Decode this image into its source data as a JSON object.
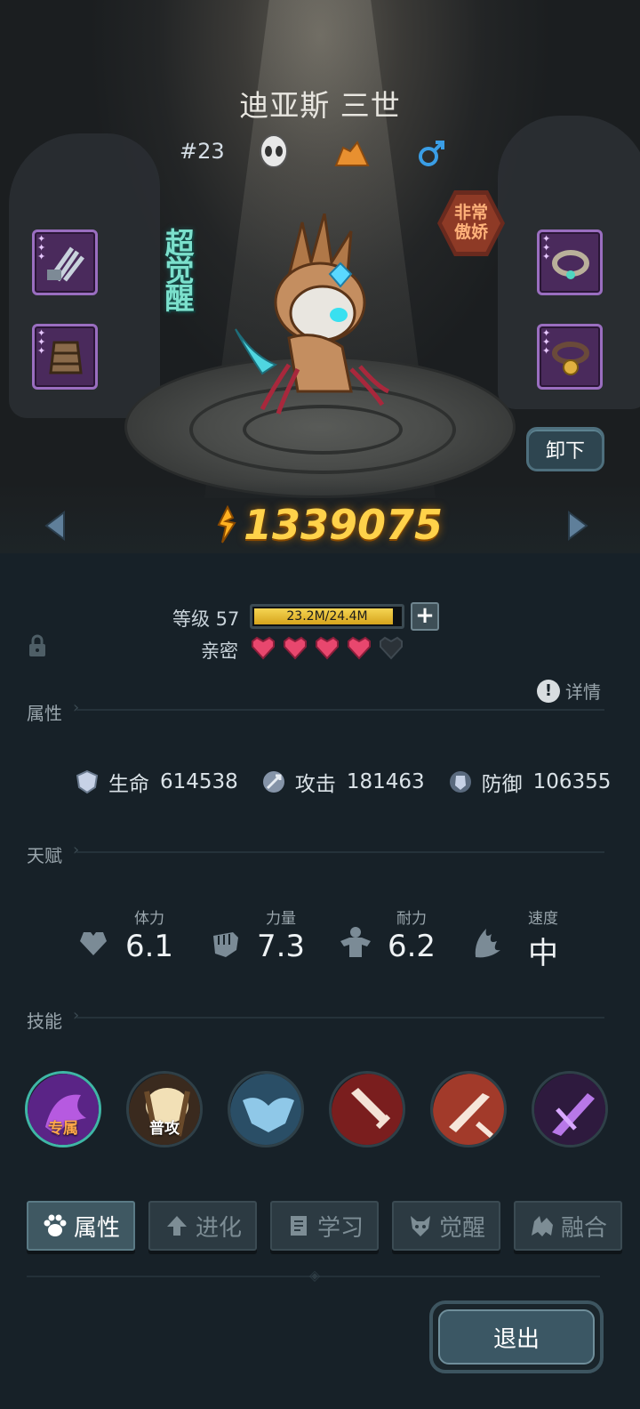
{
  "hero": {
    "name": "迪亚斯 三世",
    "id": "#23",
    "trait": "非常\n傲娇",
    "awaken_badge": "超觉醒",
    "power": "1339075"
  },
  "equipment": {
    "left": [
      {
        "icon": "claw-equip-icon"
      },
      {
        "icon": "armor-equip-icon"
      }
    ],
    "right": [
      {
        "icon": "collar-equip-icon"
      },
      {
        "icon": "bell-collar-equip-icon"
      }
    ]
  },
  "buttons": {
    "unload": "卸下",
    "exit": "退出"
  },
  "level": {
    "label": "等级 57",
    "exp_text": "23.2M/24.4M",
    "exp_fraction": 0.951
  },
  "intimacy": {
    "label": "亲密",
    "filled": 4,
    "total": 5
  },
  "details_label": "详情",
  "sections": {
    "attributes": "属性",
    "talents": "天赋",
    "skills": "技能"
  },
  "stats": [
    {
      "name": "生命",
      "value": "614538",
      "icon": "health-shield-icon"
    },
    {
      "name": "攻击",
      "value": "181463",
      "icon": "sword-icon"
    },
    {
      "name": "防御",
      "value": "106355",
      "icon": "armor-shield-icon"
    }
  ],
  "talents": [
    {
      "name": "体力",
      "value": "6.1",
      "icon": "heart-icon"
    },
    {
      "name": "力量",
      "value": "7.3",
      "icon": "fist-icon"
    },
    {
      "name": "耐力",
      "value": "6.2",
      "icon": "muscle-icon"
    },
    {
      "name": "速度",
      "value": "中",
      "icon": "wing-icon"
    }
  ],
  "skills": [
    {
      "label": "专属",
      "color": "#6a2a9a"
    },
    {
      "label": "普攻",
      "color": "#c9a66b"
    },
    {
      "label": "",
      "color": "#3f6f8e"
    },
    {
      "label": "",
      "color": "#8a2a2a"
    },
    {
      "label": "",
      "color": "#9a3a2a"
    },
    {
      "label": "",
      "color": "#4a2a6a"
    }
  ],
  "tabs": [
    {
      "label": "属性",
      "icon": "paw-icon",
      "active": true
    },
    {
      "label": "进化",
      "icon": "up-arrow-icon",
      "active": false
    },
    {
      "label": "学习",
      "icon": "book-icon",
      "active": false
    },
    {
      "label": "觉醒",
      "icon": "wolf-icon",
      "active": false
    },
    {
      "label": "融合",
      "icon": "beast-icon",
      "active": false
    }
  ],
  "colors": {
    "gold": "#ffd24a",
    "heart_filled": "#e8476e",
    "heart_empty": "#2b3238",
    "accent_teal": "#7be0cc"
  }
}
